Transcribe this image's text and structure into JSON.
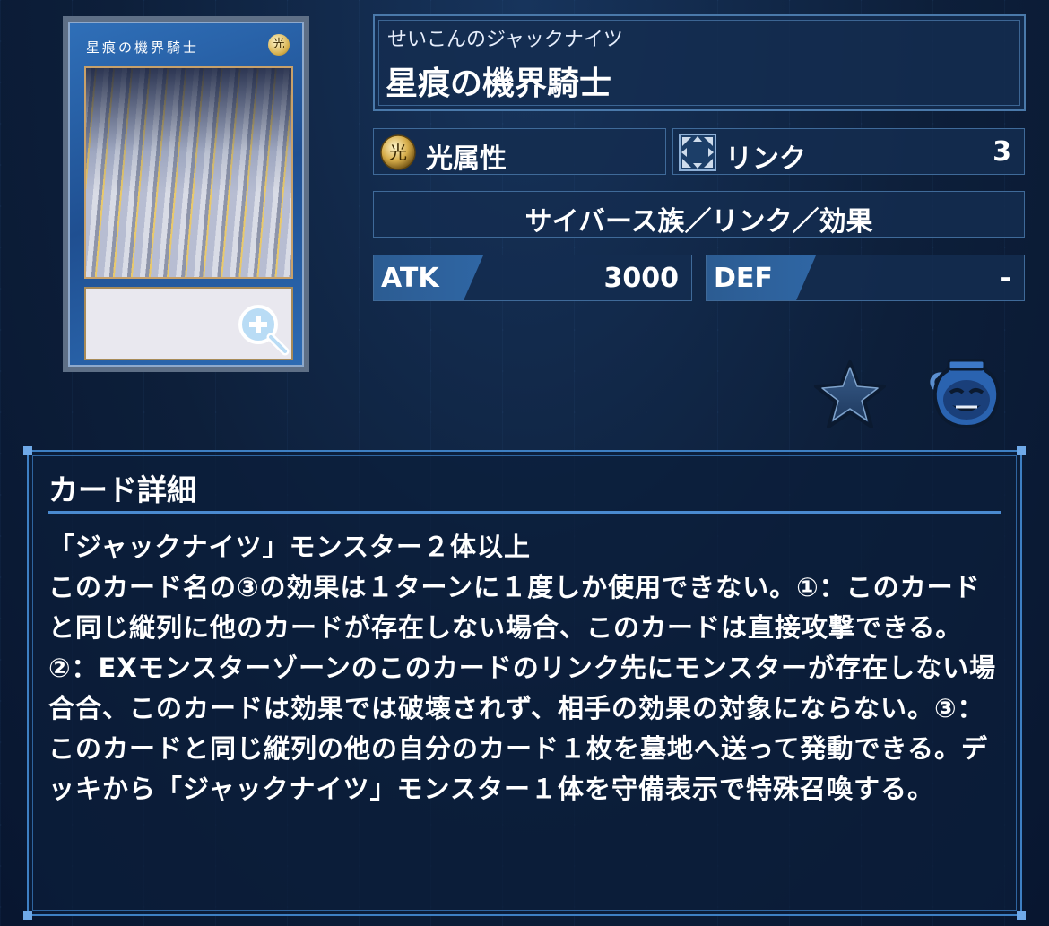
{
  "card": {
    "image_name": "星痕の機界騎士",
    "attribute_glyph": "光"
  },
  "ruby": "せいこんのジャックナイツ",
  "name": "星痕の機界騎士",
  "attribute": {
    "label": "光属性",
    "icon": "light-attribute-icon"
  },
  "link": {
    "label": "リンク",
    "value": "3",
    "icon": "link-arrows-icon"
  },
  "race": "サイバース族／リンク／効果",
  "atk": {
    "label": "ATK",
    "value": "3000"
  },
  "def": {
    "label": "DEF",
    "value": "-"
  },
  "actions": {
    "favorite_icon": "star-icon",
    "pot_icon": "pot-of-greed-icon"
  },
  "detail": {
    "heading": "カード詳細",
    "material": "「ジャックナイツ」モンスター２体以上",
    "text": "このカード名の③の効果は１ターンに１度しか使用できない。①：このカードと同じ縦列に他のカードが存在しない場合、このカードは直接攻撃できる。②：EXモンスターゾーンのこのカードのリンク先にモンスターが存在しない場合合、このカードは効果では破壊されず、相手の効果の対象にならない。③：このカードと同じ縦列の他の自分のカード１枚を墓地へ送って発動できる。デッキから「ジャックナイツ」モンスター１体を守備表示で特殊召喚する。"
  },
  "colors": {
    "background": "#0d1f3a",
    "panel": "#142d50",
    "border": "#4a79aa",
    "accent": "#3e80c4"
  }
}
